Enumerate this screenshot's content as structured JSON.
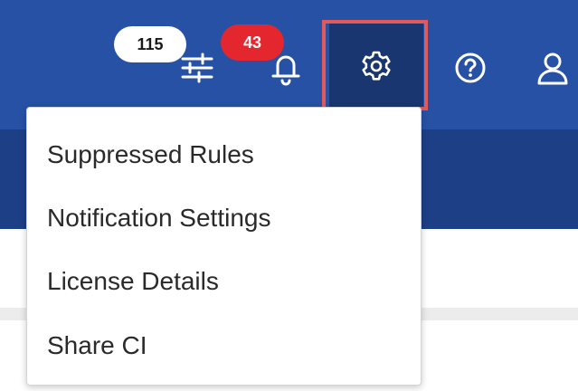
{
  "header": {
    "filter_count_badge": "115",
    "notification_count_badge": "43",
    "icons": {
      "filters": "sliders-icon",
      "notifications": "bell-icon",
      "settings": "gear-icon",
      "help": "question-circle-icon",
      "user": "user-icon"
    },
    "colors": {
      "header_bg": "#2651a5",
      "subheader_bg": "#1d3f85",
      "active_btn_bg": "#193670",
      "highlight_border": "#e05a5a",
      "alert_badge": "#e4272f"
    }
  },
  "settings_menu": {
    "items": [
      {
        "label": "Suppressed Rules"
      },
      {
        "label": "Notification Settings"
      },
      {
        "label": "License Details"
      },
      {
        "label": "Share CI"
      }
    ]
  }
}
